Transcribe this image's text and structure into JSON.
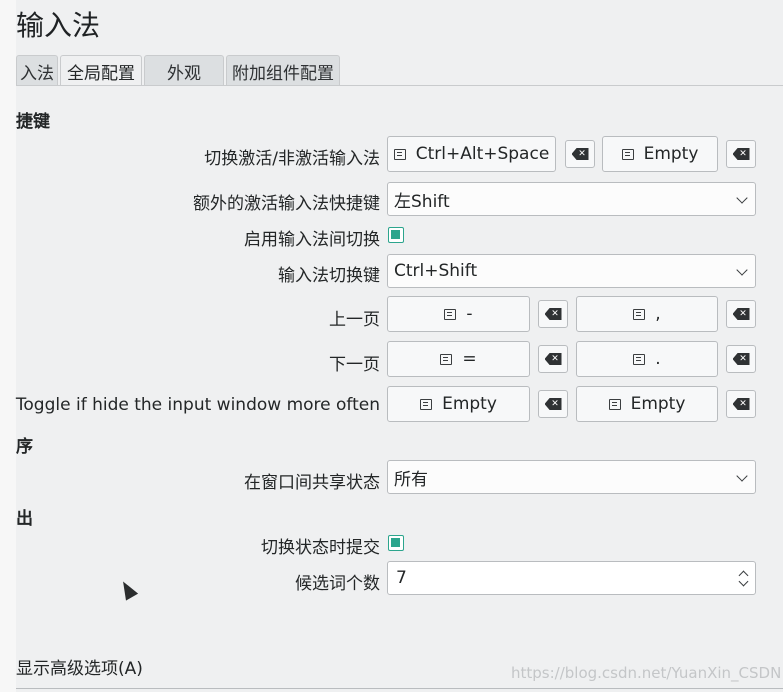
{
  "window": {
    "title": "输入法"
  },
  "tabs": [
    {
      "label": "入法"
    },
    {
      "label": "全局配置"
    },
    {
      "label": "外观"
    },
    {
      "label": "附加组件配置"
    }
  ],
  "sections": {
    "hotkeys": "捷键",
    "program": "序",
    "output": "出"
  },
  "rows": {
    "trigger": {
      "label": "切换激活/非激活输入法",
      "key1": "Ctrl+Alt+Space",
      "key2": "Empty"
    },
    "extra_trigger": {
      "label": "额外的激活输入法快捷键",
      "value": "左Shift"
    },
    "enable_switch": {
      "label": "启用输入法间切换",
      "checked": true
    },
    "switch_key": {
      "label": "输入法切换键",
      "value": "Ctrl+Shift"
    },
    "prev_page": {
      "label": "上一页",
      "key1": "-",
      "key2": ","
    },
    "next_page": {
      "label": "下一页",
      "key1": "=",
      "key2": "."
    },
    "toggle_hide": {
      "label": "Toggle if hide the input window more often",
      "key1": "Empty",
      "key2": "Empty"
    },
    "share_state": {
      "label": "在窗口间共享状态",
      "value": "所有"
    },
    "commit_on_switch": {
      "label": "切换状态时提交",
      "checked": true
    },
    "candidate_count": {
      "label": "候选词个数",
      "value": "7"
    }
  },
  "advanced": "显示高级选项(A)",
  "watermark": "https://blog.csdn.net/YuanXin_CSDN",
  "colors": {
    "accent": "#2ca58d",
    "background": "#eff0f1"
  },
  "icons": {
    "key_button": "keyboard-icon",
    "clear_button": "backspace-clear-icon"
  }
}
